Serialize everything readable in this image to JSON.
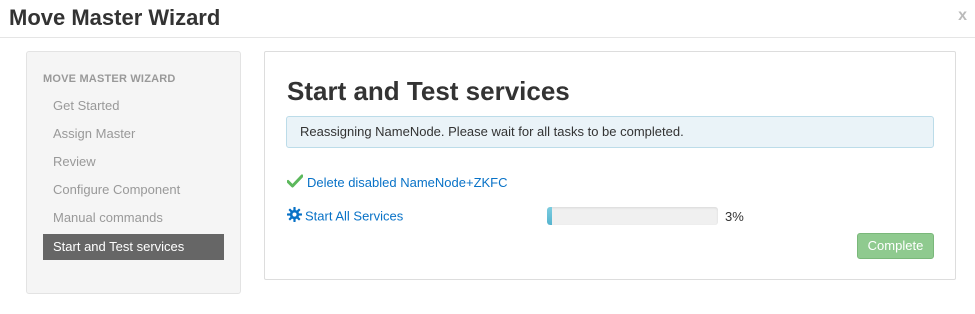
{
  "modal": {
    "title": "Move Master Wizard",
    "close_label": "x"
  },
  "sidebar": {
    "header": "MOVE MASTER WIZARD",
    "items": [
      {
        "label": "Get Started",
        "active": false
      },
      {
        "label": "Assign Master",
        "active": false
      },
      {
        "label": "Review",
        "active": false
      },
      {
        "label": "Configure Component",
        "active": false
      },
      {
        "label": "Manual commands",
        "active": false
      },
      {
        "label": "Start and Test services",
        "active": true
      }
    ]
  },
  "main": {
    "title": "Start and Test services",
    "alert": "Reassigning NameNode. Please wait for all tasks to be completed.",
    "tasks": [
      {
        "label": "Delete disabled NameNode+ZKFC",
        "status": "completed",
        "icon": "check-icon"
      },
      {
        "label": "Start All Services",
        "status": "in-progress",
        "icon": "gear-icon",
        "progress_percent": 3,
        "progress_text": "3%"
      }
    ],
    "complete_button": "Complete"
  },
  "colors": {
    "link": "#0872c7",
    "success": "#5cb85c",
    "progress": "#55b4cf",
    "active_item_bg": "#666666",
    "alert_bg": "#eaf3f8",
    "button_disabled_green": "#8fca8f"
  }
}
